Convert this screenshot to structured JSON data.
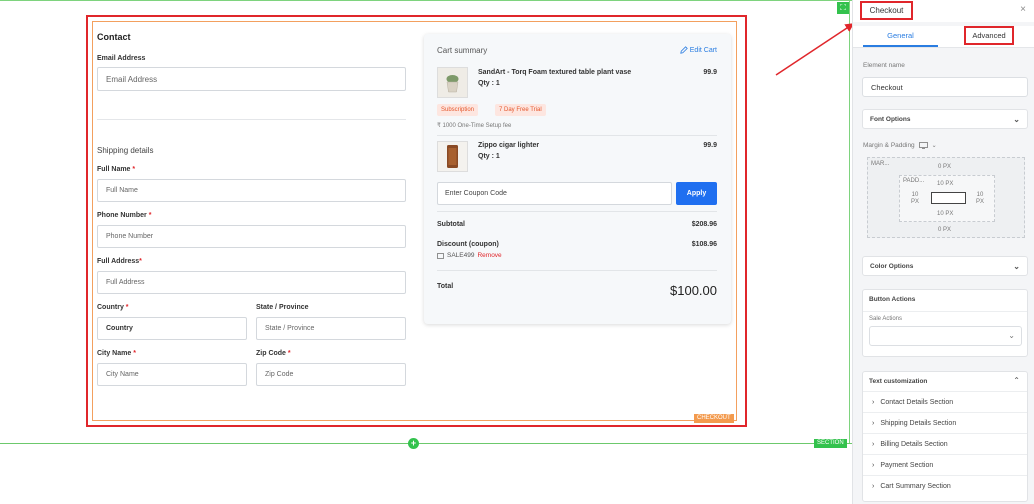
{
  "canvas": {
    "section_tag": "SECTION",
    "element_tag": "CHECKOUT",
    "add_symbol": "+",
    "corner_symbol": "⛶"
  },
  "form": {
    "contact_heading": "Contact",
    "email_label": "Email Address",
    "email_placeholder": "Email Address",
    "shipping_heading": "Shipping details",
    "fullname_label": "Full Name",
    "fullname_placeholder": "Full Name",
    "phone_label": "Phone Number",
    "phone_placeholder": "Phone Number",
    "address_label": "Full Address",
    "address_placeholder": "Full Address",
    "country_label": "Country",
    "country_value": "Country",
    "state_label": "State / Province",
    "state_placeholder": "State / Province",
    "city_label": "City Name",
    "city_placeholder": "City Name",
    "zip_label": "Zip Code",
    "zip_placeholder": "Zip Code",
    "required_mark": "*"
  },
  "cart": {
    "title": "Cart summary",
    "edit_label": "Edit Cart",
    "items": [
      {
        "name": "SandArt - Torq Foam textured table plant vase",
        "qty": "Qty : 1",
        "price": "99.9"
      },
      {
        "name": "Zippo cigar lighter",
        "qty": "Qty : 1",
        "price": "99.9"
      }
    ],
    "badges": [
      "Subscription",
      "7 Day Free Trial"
    ],
    "setup_fee": "₹ 1000 One-Time Setup fee",
    "coupon_placeholder": "Enter Coupon Code",
    "apply_label": "Apply",
    "subtotal_label": "Subtotal",
    "subtotal_value": "$208.96",
    "discount_label": "Discount (coupon)",
    "discount_value": "$108.96",
    "coupon_code": "SALE499",
    "remove_label": "Remove",
    "total_label": "Total",
    "total_value": "$100.00"
  },
  "panel": {
    "title": "Checkout",
    "close_symbol": "×",
    "tab_general": "General",
    "tab_advanced": "Advanced",
    "element_name_label": "Element name",
    "element_name_value": "Checkout",
    "font_options": "Font Options",
    "margin_padding_label": "Margin & Padding",
    "margin_label": "MAR...",
    "margin_top": "0 PX",
    "margin_bottom": "0 PX",
    "padding_label": "PADD...",
    "padding_top": "10 PX",
    "padding_bottom": "10 PX",
    "padding_left": "10",
    "padding_left_unit": "PX",
    "padding_right": "10",
    "padding_right_unit": "PX",
    "color_options": "Color Options",
    "button_actions": "Button Actions",
    "sale_actions_label": "Sale Actions",
    "text_customization": "Text customization",
    "text_items": [
      "Contact Details Section",
      "Shipping Details Section",
      "Billing Details Section",
      "Payment Section",
      "Cart Summary Section"
    ]
  },
  "colors": {
    "accent": "#2a7de1",
    "apply_button": "#1f6ff0",
    "annotation": "#e0262b",
    "guide": "#33c24d"
  }
}
